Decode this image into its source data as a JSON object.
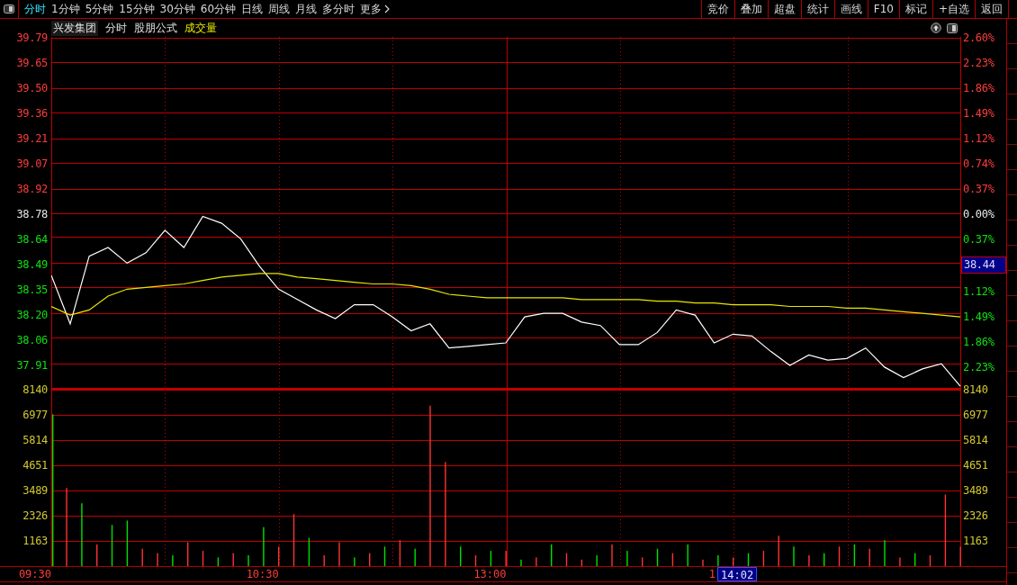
{
  "toolbar": {
    "tabs": [
      {
        "label": "分时",
        "selected": true
      },
      {
        "label": "1分钟",
        "selected": false
      },
      {
        "label": "5分钟",
        "selected": false
      },
      {
        "label": "15分钟",
        "selected": false
      },
      {
        "label": "30分钟",
        "selected": false
      },
      {
        "label": "60分钟",
        "selected": false
      },
      {
        "label": "日线",
        "selected": false
      },
      {
        "label": "周线",
        "selected": false
      },
      {
        "label": "月线",
        "selected": false
      },
      {
        "label": "多分时",
        "selected": false
      },
      {
        "label": "更多",
        "selected": false,
        "kind": "menu"
      }
    ],
    "buttons": [
      "竞价",
      "叠加",
      "超盘",
      "统计",
      "画线",
      "F10",
      "标记",
      "+自选",
      "返回"
    ]
  },
  "header": {
    "stock": "兴发集团",
    "period": "分时",
    "formula": "股朋公式",
    "indicator": "成交量"
  },
  "price_chart": {
    "right_axis": [
      {
        "text": "2.60%",
        "kind": "up"
      },
      {
        "text": "2.23%",
        "kind": "up"
      },
      {
        "text": "1.86%",
        "kind": "up"
      },
      {
        "text": "1.49%",
        "kind": "up"
      },
      {
        "text": "1.12%",
        "kind": "up"
      },
      {
        "text": "0.74%",
        "kind": "up"
      },
      {
        "text": "0.37%",
        "kind": "up"
      },
      {
        "text": "0.00%",
        "kind": "flat"
      },
      {
        "text": "0.37%",
        "kind": "down"
      },
      {
        "text": "38.44",
        "kind": "cursor"
      },
      {
        "text": "1.12%",
        "kind": "down"
      },
      {
        "text": "1.49%",
        "kind": "down"
      },
      {
        "text": "1.86%",
        "kind": "down"
      },
      {
        "text": "2.23%",
        "kind": "down"
      }
    ],
    "chart_data": {
      "type": "line",
      "categories": [
        null,
        null,
        null,
        null,
        null,
        null,
        null,
        null,
        null,
        null,
        null,
        null,
        null,
        null,
        null,
        null,
        null,
        null,
        null,
        null,
        null,
        null,
        null,
        null,
        null,
        null,
        null,
        null,
        null,
        null,
        null,
        null,
        null,
        null,
        null,
        null,
        null,
        null,
        null,
        null,
        null,
        null,
        null,
        null,
        null,
        null,
        null,
        null,
        null
      ],
      "grid": true,
      "ylim": [
        37.765,
        39.79
      ],
      "series": [
        {
          "color": "#ffffff",
          "values": [
            38.42,
            38.14,
            38.53,
            38.58,
            38.49,
            38.55,
            38.68,
            38.58,
            38.76,
            38.72,
            38.63,
            38.47,
            38.34,
            38.28,
            38.22,
            38.17,
            38.25,
            38.25,
            38.18,
            38.1,
            38.14,
            38.0,
            38.01,
            38.02,
            38.03,
            38.18,
            38.2,
            38.2,
            38.15,
            38.13,
            38.02,
            38.02,
            38.09,
            38.22,
            38.19,
            38.03,
            38.08,
            38.07,
            37.98,
            37.9,
            37.96,
            37.93,
            37.94,
            38.0,
            37.89,
            37.83,
            37.88,
            37.91,
            37.78
          ]
        },
        {
          "color": "#e8e800",
          "values": [
            38.24,
            38.19,
            38.22,
            38.3,
            38.34,
            38.35,
            38.36,
            38.37,
            38.39,
            38.41,
            38.42,
            38.43,
            38.43,
            38.41,
            38.4,
            38.39,
            38.38,
            38.37,
            38.37,
            38.36,
            38.34,
            38.31,
            38.3,
            38.29,
            38.29,
            38.29,
            38.29,
            38.29,
            38.28,
            38.28,
            38.28,
            38.28,
            38.27,
            38.27,
            38.26,
            38.26,
            38.25,
            38.25,
            38.25,
            38.24,
            38.24,
            38.24,
            38.23,
            38.23,
            38.22,
            38.21,
            38.2,
            38.19,
            38.18
          ]
        }
      ],
      "yticks": [
        {
          "value": 39.79,
          "label": "39.79"
        },
        {
          "value": 39.65,
          "label": "39.65"
        },
        {
          "value": 39.5,
          "label": "39.50"
        },
        {
          "value": 39.36,
          "label": "39.36"
        },
        {
          "value": 39.21,
          "label": "39.21"
        },
        {
          "value": 39.07,
          "label": "39.07"
        },
        {
          "value": 38.92,
          "label": "38.92"
        },
        {
          "value": 38.78,
          "label": "38.78"
        },
        {
          "value": 38.64,
          "label": "38.64"
        },
        {
          "value": 38.49,
          "label": "38.49"
        },
        {
          "value": 38.35,
          "label": "38.35"
        },
        {
          "value": 38.2,
          "label": "38.20"
        },
        {
          "value": 38.06,
          "label": "38.06"
        },
        {
          "value": 37.91,
          "label": "37.91"
        }
      ]
    }
  },
  "volume_chart": {
    "right_axis": [
      "8140",
      "6977",
      "5814",
      "4651",
      "3489",
      "2326",
      "1163"
    ],
    "chart_data": {
      "type": "bar",
      "categories": [
        null,
        null,
        null,
        null,
        null,
        null,
        null,
        null,
        null,
        null,
        null,
        null,
        null,
        null,
        null,
        null,
        null,
        null,
        null,
        null,
        null,
        null,
        null,
        null,
        null,
        null,
        null,
        null,
        null,
        null,
        null,
        null,
        null,
        null,
        null,
        null,
        null,
        null,
        null,
        null,
        null,
        null,
        null,
        null,
        null,
        null,
        null,
        null,
        null,
        null,
        null,
        null,
        null,
        null,
        null,
        null,
        null,
        null,
        null,
        null,
        null
      ],
      "stacked": true,
      "grid": true,
      "ylim": [
        0,
        8140
      ],
      "series": [
        {
          "color": "#ff3232",
          "values": [
            0,
            3600,
            0,
            1000,
            0,
            0,
            800,
            600,
            0,
            1100,
            700,
            0,
            600,
            0,
            0,
            900,
            2400,
            0,
            500,
            1100,
            0,
            600,
            0,
            1200,
            0,
            7400,
            4800,
            0,
            500,
            0,
            700,
            0,
            400,
            0,
            600,
            300,
            0,
            1000,
            0,
            400,
            0,
            600,
            0,
            300,
            0,
            400,
            0,
            700,
            1400,
            0,
            500,
            0,
            900,
            0,
            800,
            0,
            400,
            0,
            500,
            3300,
            900
          ]
        },
        {
          "color": "#00e000",
          "values": [
            7000,
            0,
            2900,
            0,
            1900,
            2100,
            0,
            0,
            500,
            0,
            0,
            400,
            0,
            500,
            1800,
            0,
            0,
            1300,
            0,
            0,
            400,
            0,
            900,
            0,
            800,
            0,
            0,
            900,
            0,
            700,
            0,
            300,
            0,
            1000,
            0,
            0,
            500,
            0,
            700,
            0,
            800,
            0,
            1000,
            0,
            500,
            0,
            600,
            0,
            0,
            900,
            0,
            600,
            0,
            1000,
            0,
            1200,
            0,
            600,
            0,
            0,
            0
          ]
        }
      ],
      "yticks": [
        8140,
        6977,
        5814,
        4651,
        3489,
        2326,
        1163
      ]
    }
  },
  "time_axis": {
    "labels": [
      "09:30",
      "10:30",
      "13:00",
      "1"
    ],
    "cursor": "14:02"
  }
}
